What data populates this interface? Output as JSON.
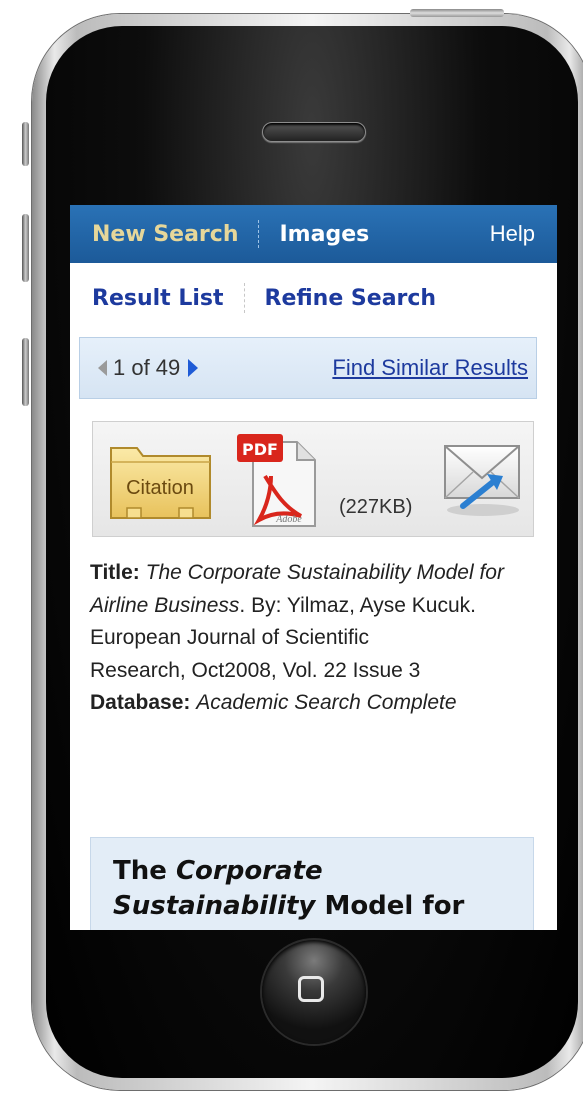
{
  "topnav": {
    "new_search": "New Search",
    "images": "Images",
    "help": "Help"
  },
  "subnav": {
    "result_list": "Result List",
    "refine_search": "Refine Search"
  },
  "pager": {
    "position": "1 of 49",
    "find_similar": "Find Similar Results"
  },
  "toolbar": {
    "citation_label": "Citation",
    "pdf_label": "PDF",
    "pdf_brand": "Adobe",
    "pdf_size": "(227KB)"
  },
  "record": {
    "title_label": "Title:",
    "title_value": "The Corporate Sustainability Model for Airline Business",
    "authors": ". By: Yilmaz, Ayse Kucuk.",
    "journal_line1": "European Journal of Scientific",
    "journal_line2": "Research, Oct2008, Vol. 22 Issue 3",
    "database_label": "Database:",
    "database_value": "Academic Search Complete"
  },
  "abstract_header": {
    "part1": "The ",
    "part2": "Corporate",
    "part3": "Sustainability",
    "part4": " Model for"
  },
  "colors": {
    "nav_blue": "#1f62a6",
    "active_nav": "#e6d79a",
    "link_blue": "#1d3a9e",
    "pager_bg": "#dde9f5",
    "abstract_bg": "#e3edf7"
  }
}
